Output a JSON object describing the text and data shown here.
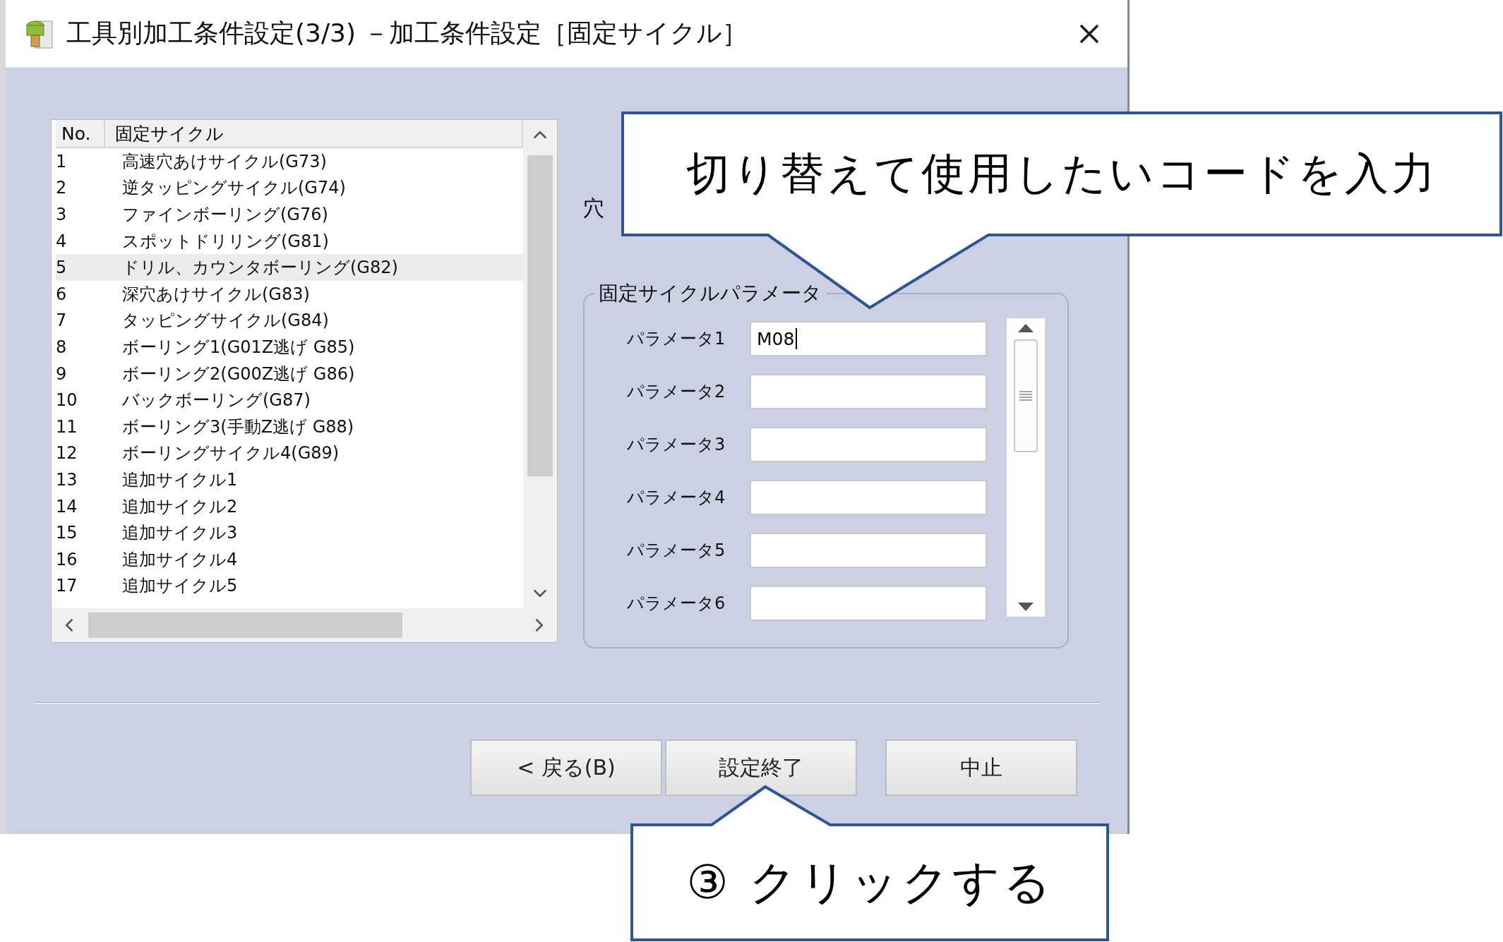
{
  "window": {
    "title": "工具別加工条件設定(3/3) －加工条件設定［固定サイクル］"
  },
  "cycle_list": {
    "columns": [
      "No.",
      "固定サイクル"
    ],
    "rows": [
      {
        "no": "1",
        "name": "高速穴あけサイクル(G73)",
        "selected": false
      },
      {
        "no": "2",
        "name": "逆タッピングサイクル(G74)",
        "selected": false
      },
      {
        "no": "3",
        "name": "ファインボーリング(G76)",
        "selected": false
      },
      {
        "no": "4",
        "name": "スポットドリリング(G81)",
        "selected": false
      },
      {
        "no": "5",
        "name": "ドリル、カウンタボーリング(G82)",
        "selected": true
      },
      {
        "no": "6",
        "name": "深穴あけサイクル(G83)",
        "selected": false
      },
      {
        "no": "7",
        "name": "タッピングサイクル(G84)",
        "selected": false
      },
      {
        "no": "8",
        "name": "ボーリング1(G01Z逃げ G85)",
        "selected": false
      },
      {
        "no": "9",
        "name": "ボーリング2(G00Z逃げ G86)",
        "selected": false
      },
      {
        "no": "10",
        "name": "バックボーリング(G87)",
        "selected": false
      },
      {
        "no": "11",
        "name": "ボーリング3(手動Z逃げ G88)",
        "selected": false
      },
      {
        "no": "12",
        "name": "ボーリングサイクル4(G89)",
        "selected": false
      },
      {
        "no": "13",
        "name": "追加サイクル1",
        "selected": false
      },
      {
        "no": "14",
        "name": "追加サイクル2",
        "selected": false
      },
      {
        "no": "15",
        "name": "追加サイクル3",
        "selected": false
      },
      {
        "no": "16",
        "name": "追加サイクル4",
        "selected": false
      },
      {
        "no": "17",
        "name": "追加サイクル5",
        "selected": false
      }
    ]
  },
  "partial_label": "穴",
  "parameters": {
    "title": "固定サイクルパラメータ",
    "fields": [
      {
        "label": "パラメータ1",
        "value": "M08",
        "focused": true
      },
      {
        "label": "パラメータ2",
        "focused": false
      },
      {
        "label": "パラメータ3",
        "focused": false
      },
      {
        "label": "パラメータ4",
        "focused": false
      },
      {
        "label": "パラメータ5",
        "focused": false
      },
      {
        "label": "パラメータ6",
        "focused": false
      }
    ]
  },
  "buttons": [
    {
      "label": "< 戻る(B)"
    },
    {
      "label": "設定終了"
    },
    {
      "label": "中止"
    }
  ],
  "callouts": [
    {
      "text": "切り替えて使用したいコードを入力"
    },
    {
      "text": "③ クリックする"
    }
  ]
}
